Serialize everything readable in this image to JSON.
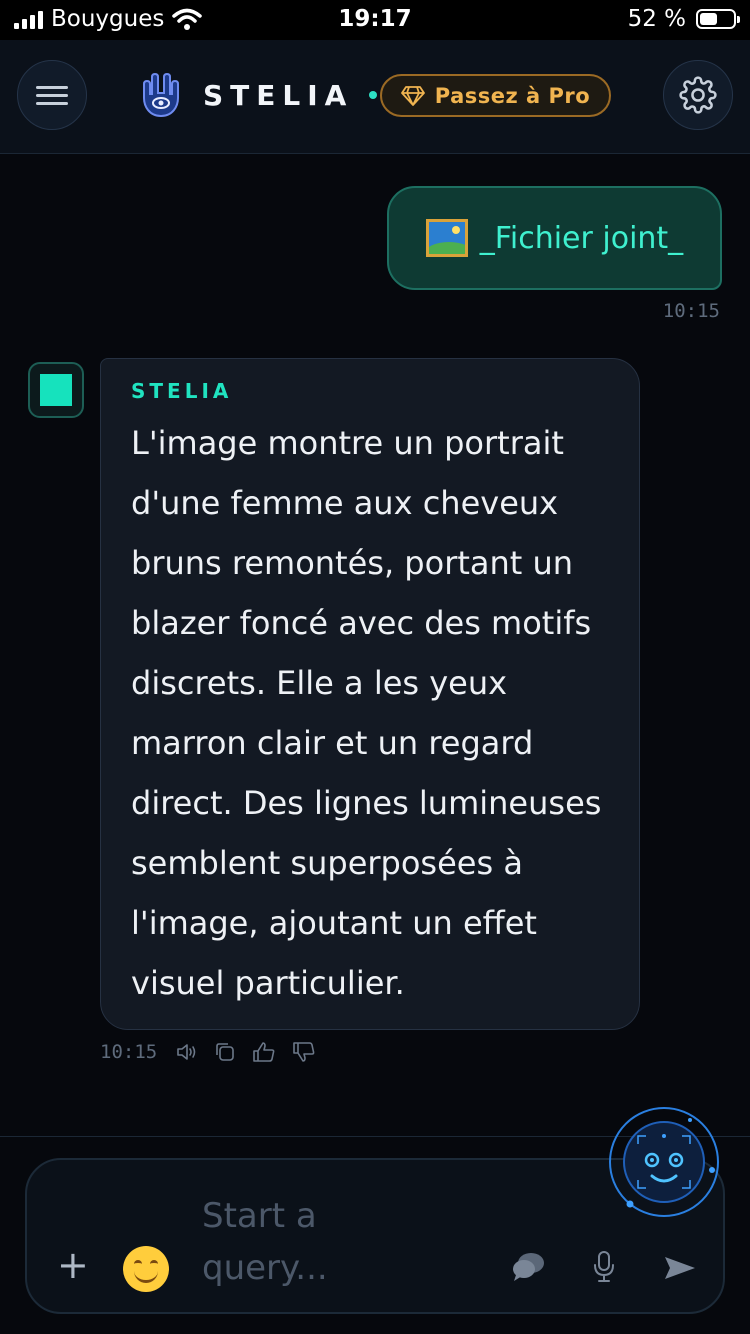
{
  "status_bar": {
    "carrier": "Bouygues",
    "time": "19:17",
    "battery_text": "52 %",
    "battery_level_fraction": 0.52
  },
  "header": {
    "brand": "STELIA",
    "pro_button": "Passez à Pro",
    "accent_color": "#20e3c0",
    "pro_color": "#f0b450"
  },
  "chat": {
    "user_message": {
      "text": "_Fichier joint_",
      "icon": "framed-picture-icon",
      "time": "10:15"
    },
    "bot_message": {
      "sender": "STELIA",
      "text": "L'image montre un portrait d'une femme aux cheveux bruns remontés, portant un blazer foncé avec des motifs discrets. Elle a les yeux marron clair et un regard direct. Des lignes lumineuses semblent superposées à l'image, ajoutant un effet visuel particulier.",
      "time": "10:15",
      "actions": [
        "speaker-icon",
        "copy-icon",
        "thumbs-up-icon",
        "thumbs-down-icon"
      ]
    }
  },
  "composer": {
    "placeholder": "Start a query..."
  }
}
